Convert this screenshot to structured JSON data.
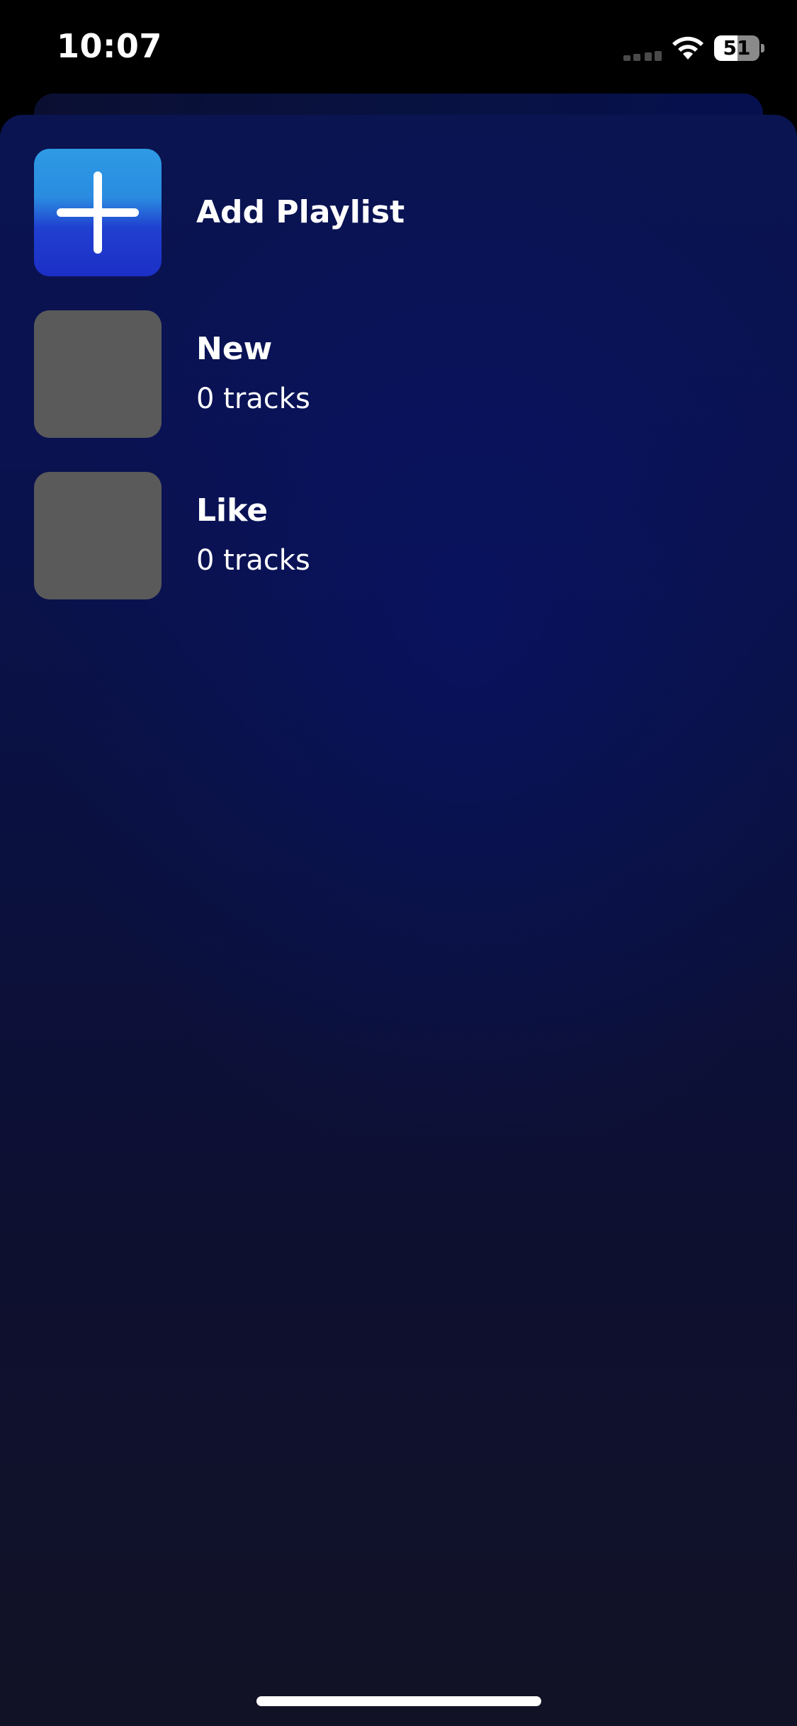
{
  "status_bar": {
    "time": "10:07",
    "battery_level": "51",
    "battery_fraction": 0.51,
    "icons": [
      "signal-icon",
      "wifi-icon",
      "battery-icon"
    ]
  },
  "playlists": {
    "add": {
      "label": "Add Playlist",
      "icon": "plus-icon"
    },
    "items": [
      {
        "title": "New",
        "subtitle": "0 tracks"
      },
      {
        "title": "Like",
        "subtitle": "0 tracks"
      }
    ]
  },
  "colors": {
    "background": "#0a1250",
    "add_tile_top": "#2e9ae4",
    "add_tile_bottom": "#1c2fc6",
    "placeholder_tile": "#5a5a5a",
    "text": "#ffffff"
  }
}
